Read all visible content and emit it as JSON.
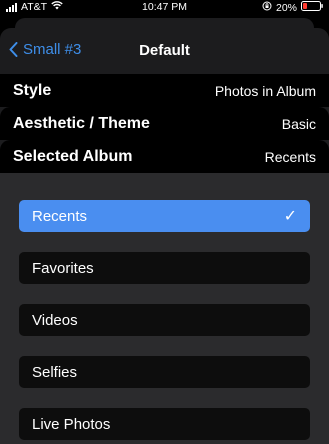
{
  "status_bar": {
    "carrier": "AT&T",
    "time": "10:47 PM",
    "battery": "20%"
  },
  "nav": {
    "back_label": "Small #3",
    "title": "Default"
  },
  "settings": [
    {
      "label": "Style",
      "value": "Photos in Album"
    },
    {
      "label": "Aesthetic / Theme",
      "value": "Basic"
    },
    {
      "label": "Selected Album",
      "value": "Recents"
    }
  ],
  "albums": {
    "selected_index": 0,
    "check_glyph": "✓",
    "options": [
      {
        "label": "Recents"
      },
      {
        "label": "Favorites"
      },
      {
        "label": "Videos"
      },
      {
        "label": "Selfies"
      },
      {
        "label": "Live Photos"
      }
    ]
  },
  "colors": {
    "accent": "#3e8ee9",
    "selected": "#4a8ef0",
    "battery_low": "#ff3b30"
  },
  "icons": {
    "signal": "signal-bars-icon",
    "wifi": "wifi-icon",
    "rotation_lock": "rotation-lock-icon",
    "battery": "battery-icon",
    "back": "chevron-left-icon",
    "check": "checkmark-icon"
  }
}
